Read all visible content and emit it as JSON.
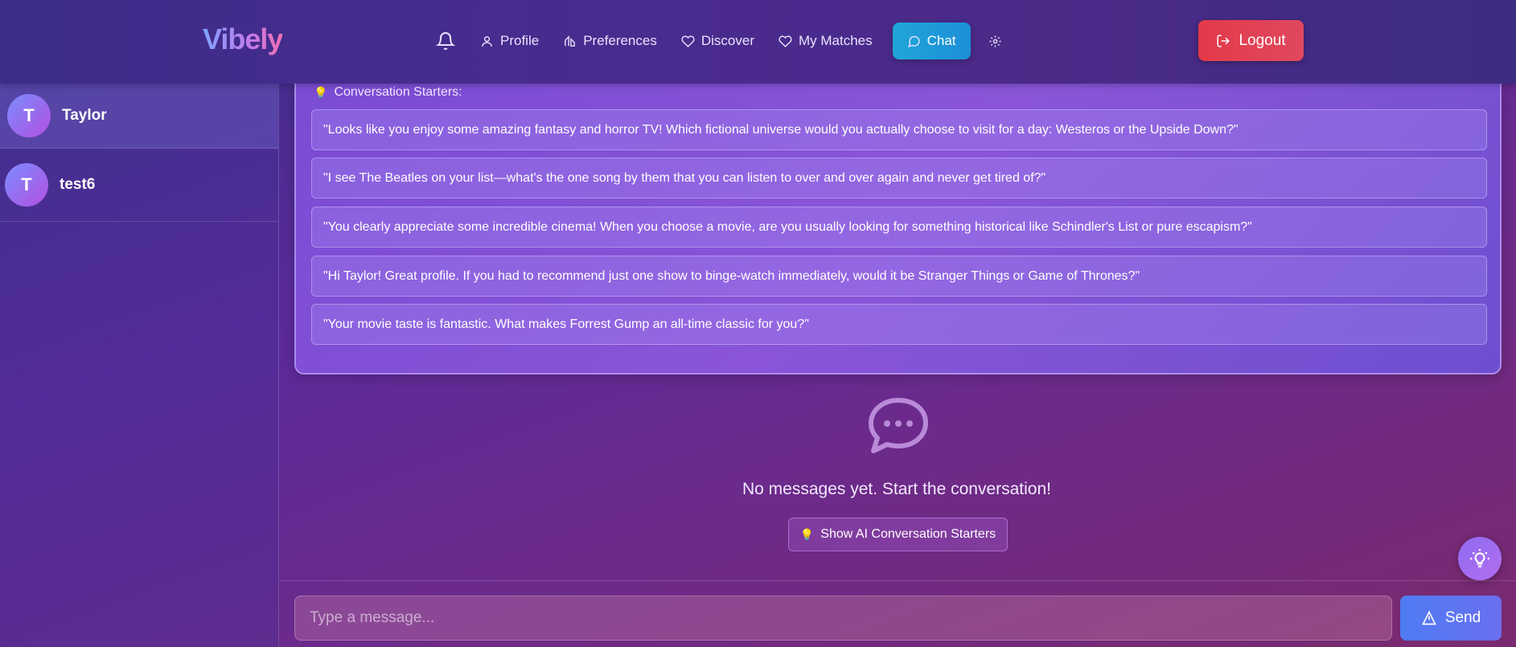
{
  "header": {
    "logo": "Vibely",
    "nav": {
      "profile": "Profile",
      "preferences": "Preferences",
      "discover": "Discover",
      "matches": "My Matches",
      "chat": "Chat"
    },
    "logout": "Logout"
  },
  "sidebar": {
    "chats": [
      {
        "initial": "T",
        "name": "Taylor"
      },
      {
        "initial": "T",
        "name": "test6"
      }
    ]
  },
  "starters": {
    "title": "Conversation Starters:",
    "items": [
      "\"Looks like you enjoy some amazing fantasy and horror TV! Which fictional universe would you actually choose to visit for a day: Westeros or the Upside Down?\"",
      "\"I see The Beatles on your list—what's the one song by them that you can listen to over and over again and never get tired of?\"",
      "\"You clearly appreciate some incredible cinema! When you choose a movie, are you usually looking for something historical like Schindler's List or pure escapism?\"",
      "\"Hi Taylor! Great profile. If you had to recommend just one show to binge-watch immediately, would it be Stranger Things or Game of Thrones?\"",
      "\"Your movie taste is fantastic. What makes Forrest Gump an all-time classic for you?\""
    ]
  },
  "empty_state": {
    "text": "No messages yet. Start the conversation!",
    "button": "Show AI Conversation Starters"
  },
  "composer": {
    "placeholder": "Type a message...",
    "send": "Send"
  }
}
